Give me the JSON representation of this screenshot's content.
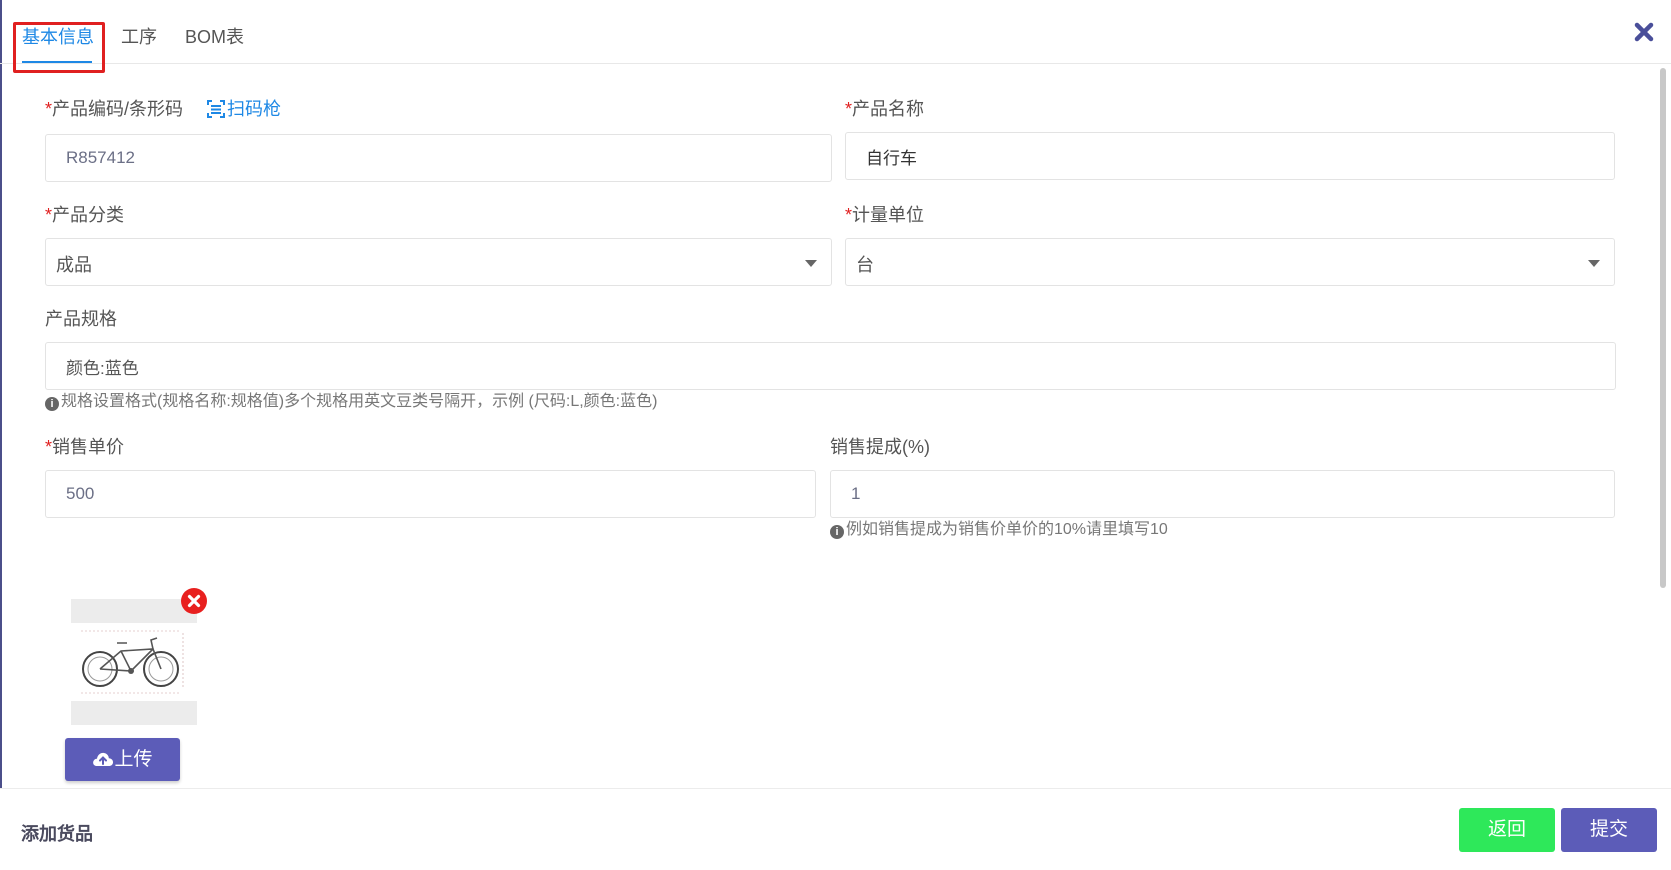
{
  "tabs": [
    {
      "label": "基本信息",
      "active": true
    },
    {
      "label": "工序",
      "active": false
    },
    {
      "label": "BOM表",
      "active": false
    }
  ],
  "form": {
    "product_code": {
      "label": "产品编码/条形码",
      "required": "*",
      "value": "R857412",
      "scan_label": "扫码枪"
    },
    "product_name": {
      "label": "产品名称",
      "required": "*",
      "value": "自行车"
    },
    "category": {
      "label": "产品分类",
      "required": "*",
      "value": "成品"
    },
    "unit": {
      "label": "计量单位",
      "required": "*",
      "value": "台"
    },
    "spec": {
      "label": "产品规格",
      "value": "颜色:蓝色",
      "hint": "规格设置格式(规格名称:规格值)多个规格用英文豆类号隔开，示例 (尺码:L,颜色:蓝色)"
    },
    "price": {
      "label": "销售单价",
      "required": "*",
      "value": "500"
    },
    "commission": {
      "label": "销售提成(%)",
      "value": "1",
      "hint": "例如销售提成为销售价单价的10%请里填写10"
    }
  },
  "image": {
    "upload_label": "上传"
  },
  "footer": {
    "title": "添加货品",
    "back_label": "返回",
    "submit_label": "提交"
  },
  "colors": {
    "accent": "#1e88e5",
    "required": "#e02020",
    "primary_button": "#5c5cb8",
    "back_button": "#2ee85a"
  }
}
